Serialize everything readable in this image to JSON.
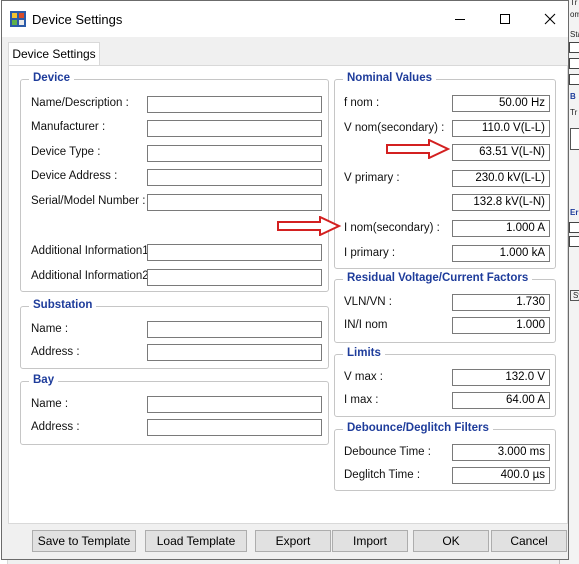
{
  "window": {
    "title": "Device Settings"
  },
  "tabs": [
    "Device Settings"
  ],
  "device": {
    "title": "Device",
    "fields": [
      {
        "label": "Name/Description :",
        "value": ""
      },
      {
        "label": "Manufacturer :",
        "value": ""
      },
      {
        "label": "Device Type :",
        "value": ""
      },
      {
        "label": "Device Address :",
        "value": ""
      },
      {
        "label": "Serial/Model Number :",
        "value": ""
      },
      {
        "label": "Additional Information1 :",
        "value": ""
      },
      {
        "label": "Additional Information2 :",
        "value": ""
      }
    ]
  },
  "substation": {
    "title": "Substation",
    "fields": [
      {
        "label": "Name :",
        "value": ""
      },
      {
        "label": "Address :",
        "value": ""
      }
    ]
  },
  "bay": {
    "title": "Bay",
    "fields": [
      {
        "label": "Name :",
        "value": ""
      },
      {
        "label": "Address :",
        "value": ""
      }
    ]
  },
  "nominal": {
    "title": "Nominal Values",
    "fnom_label": "f nom :",
    "fnom_value": "50.00 Hz",
    "vnom_label": "V nom(secondary) :",
    "vnom_value": "110.0 V(L-L)",
    "vnom_ln_value": "63.51 V(L-N)",
    "vprimary_label": "V primary :",
    "vprimary_value": "230.0 kV(L-L)",
    "vprimary_ln_value": "132.8 kV(L-N)",
    "inom_label": "I nom(secondary) :",
    "inom_value": "1.000 A",
    "iprimary_label": "I primary :",
    "iprimary_value": "1.000 kA"
  },
  "residual": {
    "title": "Residual Voltage/Current Factors",
    "vln_label": "VLN/VN :",
    "vln_value": "1.730",
    "in_label": "IN/I nom",
    "in_value": "1.000"
  },
  "limits": {
    "title": "Limits",
    "vmax_label": "V max :",
    "vmax_value": "132.0 V",
    "imax_label": "I max :",
    "imax_value": "64.00 A"
  },
  "debounce": {
    "title": "Debounce/Deglitch Filters",
    "debounce_label": "Debounce Time :",
    "debounce_value": "3.000 ms",
    "deglitch_label": "Deglitch Time :",
    "deglitch_value": "400.0 µs"
  },
  "buttons": {
    "save_template": "Save to Template",
    "load_template": "Load Template",
    "export": "Export",
    "import": "Import",
    "ok": "OK",
    "cancel": "Cancel"
  },
  "background_app": {
    "fragments": [
      "Tr",
      "om",
      "Sta",
      "B",
      "Tr",
      "Er",
      "Sy"
    ]
  },
  "colors": {
    "group_title": "#1e3c9b",
    "arrow": "#d32020"
  }
}
